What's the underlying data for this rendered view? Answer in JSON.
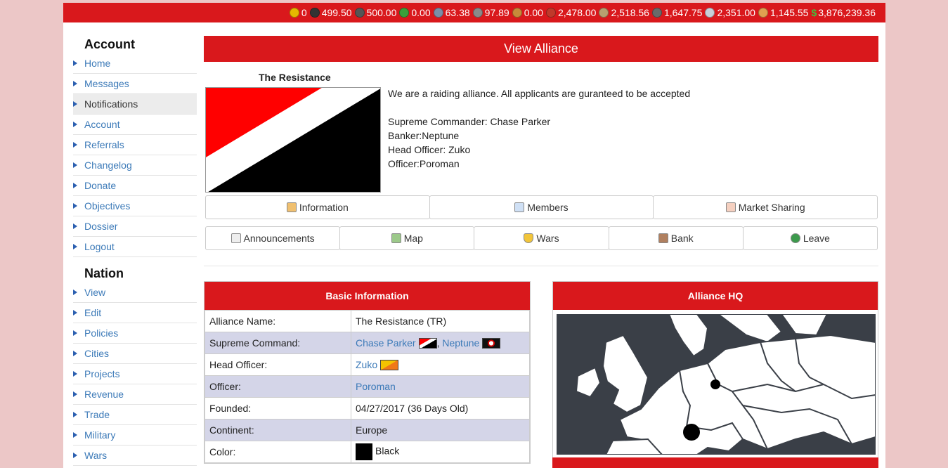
{
  "resources": [
    {
      "icon": "credits-icon",
      "color": "#e6b800",
      "value": "0"
    },
    {
      "icon": "coal-icon",
      "color": "#333333",
      "value": "499.50"
    },
    {
      "icon": "oil-icon",
      "color": "#555555",
      "value": "500.00"
    },
    {
      "icon": "uranium-icon",
      "color": "#3aa03a",
      "value": "0.00"
    },
    {
      "icon": "lead-icon",
      "color": "#7a8fa8",
      "value": "63.38"
    },
    {
      "icon": "iron-icon",
      "color": "#8a8a8a",
      "value": "97.89"
    },
    {
      "icon": "bauxite-icon",
      "color": "#c88a3a",
      "value": "0.00"
    },
    {
      "icon": "gasoline-icon",
      "color": "#c0392b",
      "value": "2,478.00"
    },
    {
      "icon": "munitions-icon",
      "color": "#b8a070",
      "value": "2,518.56"
    },
    {
      "icon": "steel-icon",
      "color": "#6a6a6a",
      "value": "1,647.75"
    },
    {
      "icon": "aluminum-icon",
      "color": "#c8d0d8",
      "value": "2,351.00"
    },
    {
      "icon": "food-icon",
      "color": "#e0a050",
      "value": "1,145.55"
    },
    {
      "icon": "money-icon",
      "color": "#3ec43e",
      "value": "3,876,239.36"
    }
  ],
  "sidebar": {
    "account_heading": "Account",
    "account_items": [
      "Home",
      "Messages",
      "Notifications",
      "Account",
      "Referrals",
      "Changelog",
      "Donate",
      "Objectives",
      "Dossier",
      "Logout"
    ],
    "nation_heading": "Nation",
    "nation_items": [
      "View",
      "Edit",
      "Policies",
      "Cities",
      "Projects",
      "Revenue",
      "Trade",
      "Military",
      "Wars"
    ]
  },
  "main": {
    "title": "View Alliance",
    "alliance_name": "The Resistance",
    "description": "We are a raiding alliance. All applicants are guranteed to be accepted",
    "leaders": [
      "Supreme Commander: Chase Parker",
      "Banker:Neptune",
      "Head Officer: Zuko",
      "Officer:Poroman"
    ],
    "buttons_row1": [
      "Information",
      "Members",
      "Market Sharing"
    ],
    "buttons_row2": [
      "Announcements",
      "Map",
      "Wars",
      "Bank",
      "Leave"
    ]
  },
  "basic_info": {
    "heading": "Basic Information",
    "rows": {
      "alliance_name": {
        "key": "Alliance Name:",
        "value": "The Resistance (TR)"
      },
      "supreme_command": {
        "key": "Supreme Command:",
        "value1": "Chase Parker",
        "sep": ", ",
        "value2": "Neptune"
      },
      "head_officer": {
        "key": "Head Officer:",
        "value": "Zuko"
      },
      "officer": {
        "key": "Officer:",
        "value": "Poroman"
      },
      "founded": {
        "key": "Founded:",
        "value": "04/27/2017 (36 Days Old)"
      },
      "continent": {
        "key": "Continent:",
        "value": "Europe"
      },
      "color": {
        "key": "Color:",
        "value": "Black"
      }
    }
  },
  "hq": {
    "heading": "Alliance HQ"
  }
}
